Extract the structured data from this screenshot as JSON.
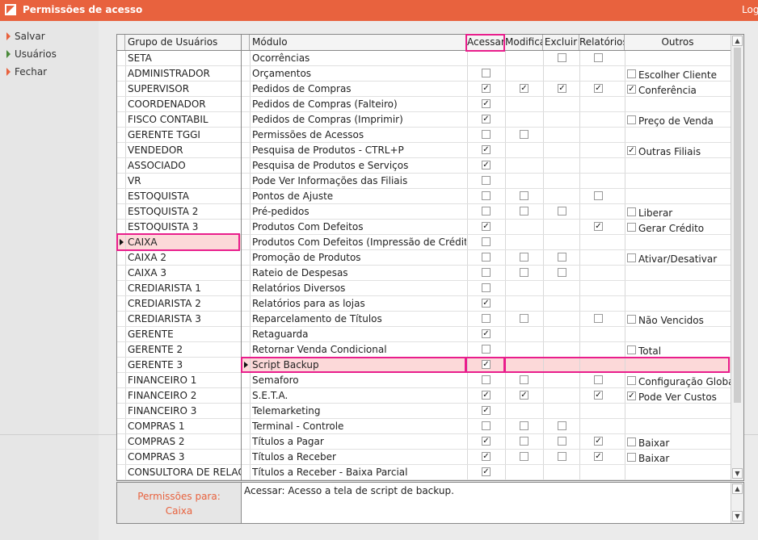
{
  "window": {
    "title": "Permissões de acesso",
    "logout_label": "Log"
  },
  "sidebar": {
    "items": [
      {
        "label": "Salvar"
      },
      {
        "label": "Usuários"
      },
      {
        "label": "Fechar"
      }
    ]
  },
  "groups": {
    "header": "Grupo de Usuários",
    "selected": "CAIXA",
    "rows": [
      "SETA",
      "ADMINISTRADOR",
      "SUPERVISOR",
      "COORDENADOR",
      "FISCO CONTABIL",
      "GERENTE TGGI",
      "VENDEDOR",
      "ASSOCIADO",
      "VR",
      "ESTOQUISTA",
      "ESTOQUISTA 2",
      "ESTOQUISTA 3",
      "CAIXA",
      "CAIXA 2",
      "CAIXA 3",
      "CREDIARISTA 1",
      "CREDIARISTA 2",
      "CREDIARISTA 3",
      "GERENTE",
      "GERENTE 2",
      "GERENTE 3",
      "FINANCEIRO 1",
      "FINANCEIRO 2",
      "FINANCEIRO 3",
      "COMPRAS 1",
      "COMPRAS 2",
      "COMPRAS 3",
      "CONSULTORA DE RELACI"
    ]
  },
  "permissions_for": {
    "label": "Permissões para:",
    "value": "Caixa"
  },
  "modules": {
    "headers": {
      "modulo": "Módulo",
      "acessar": "Acessar",
      "modifica": "Modifica",
      "excluir": "Excluir",
      "relatorios": "Relatórios",
      "outros": "Outros"
    },
    "selected": "Script Backup",
    "rows": [
      {
        "name": "Ocorrências",
        "acessar": null,
        "modifica": null,
        "excluir": false,
        "relatorios": false,
        "outros": null,
        "outros_checked": false
      },
      {
        "name": "Orçamentos",
        "acessar": false,
        "modifica": null,
        "excluir": null,
        "relatorios": null,
        "outros": "Escolher Cliente",
        "outros_checked": false
      },
      {
        "name": "Pedidos de Compras",
        "acessar": true,
        "modifica": true,
        "excluir": true,
        "relatorios": true,
        "outros": "Conferência",
        "outros_checked": true
      },
      {
        "name": "Pedidos de Compras (Falteiro)",
        "acessar": true,
        "modifica": null,
        "excluir": null,
        "relatorios": null,
        "outros": null,
        "outros_checked": false
      },
      {
        "name": "Pedidos de Compras (Imprimir)",
        "acessar": true,
        "modifica": null,
        "excluir": null,
        "relatorios": null,
        "outros": "Preço de Venda",
        "outros_checked": false
      },
      {
        "name": "Permissões de Acessos",
        "acessar": false,
        "modifica": false,
        "excluir": null,
        "relatorios": null,
        "outros": null,
        "outros_checked": false
      },
      {
        "name": "Pesquisa de Produtos - CTRL+P",
        "acessar": true,
        "modifica": null,
        "excluir": null,
        "relatorios": null,
        "outros": "Outras Filiais",
        "outros_checked": true
      },
      {
        "name": "Pesquisa de Produtos e Serviços",
        "acessar": true,
        "modifica": null,
        "excluir": null,
        "relatorios": null,
        "outros": null,
        "outros_checked": false
      },
      {
        "name": "Pode Ver Informações das Filiais",
        "acessar": false,
        "modifica": null,
        "excluir": null,
        "relatorios": null,
        "outros": null,
        "outros_checked": false
      },
      {
        "name": "Pontos de Ajuste",
        "acessar": false,
        "modifica": false,
        "excluir": null,
        "relatorios": false,
        "outros": null,
        "outros_checked": false
      },
      {
        "name": "Pré-pedidos",
        "acessar": false,
        "modifica": false,
        "excluir": false,
        "relatorios": null,
        "outros": "Liberar",
        "outros_checked": false
      },
      {
        "name": "Produtos Com Defeitos",
        "acessar": true,
        "modifica": null,
        "excluir": null,
        "relatorios": true,
        "outros": "Gerar Crédito",
        "outros_checked": false
      },
      {
        "name": "Produtos Com Defeitos (Impressão de Crédito)",
        "acessar": false,
        "modifica": null,
        "excluir": null,
        "relatorios": null,
        "outros": null,
        "outros_checked": false
      },
      {
        "name": "Promoção de Produtos",
        "acessar": false,
        "modifica": false,
        "excluir": false,
        "relatorios": null,
        "outros": "Ativar/Desativar",
        "outros_checked": false
      },
      {
        "name": "Rateio de Despesas",
        "acessar": false,
        "modifica": false,
        "excluir": false,
        "relatorios": null,
        "outros": null,
        "outros_checked": false
      },
      {
        "name": "Relatórios Diversos",
        "acessar": false,
        "modifica": null,
        "excluir": null,
        "relatorios": null,
        "outros": null,
        "outros_checked": false
      },
      {
        "name": "Relatórios para as lojas",
        "acessar": true,
        "modifica": null,
        "excluir": null,
        "relatorios": null,
        "outros": null,
        "outros_checked": false
      },
      {
        "name": "Reparcelamento de Títulos",
        "acessar": false,
        "modifica": false,
        "excluir": null,
        "relatorios": false,
        "outros": "Não Vencidos",
        "outros_checked": false
      },
      {
        "name": "Retaguarda",
        "acessar": true,
        "modifica": null,
        "excluir": null,
        "relatorios": null,
        "outros": null,
        "outros_checked": false
      },
      {
        "name": "Retornar Venda Condicional",
        "acessar": false,
        "modifica": null,
        "excluir": null,
        "relatorios": null,
        "outros": "Total",
        "outros_checked": false
      },
      {
        "name": "Script Backup",
        "acessar": true,
        "modifica": null,
        "excluir": null,
        "relatorios": null,
        "outros": null,
        "outros_checked": false
      },
      {
        "name": "Semaforo",
        "acessar": false,
        "modifica": false,
        "excluir": null,
        "relatorios": false,
        "outros": "Configuração Global",
        "outros_checked": false
      },
      {
        "name": "S.E.T.A.",
        "acessar": true,
        "modifica": true,
        "excluir": null,
        "relatorios": true,
        "outros": "Pode Ver Custos",
        "outros_checked": true
      },
      {
        "name": "Telemarketing",
        "acessar": true,
        "modifica": null,
        "excluir": null,
        "relatorios": null,
        "outros": null,
        "outros_checked": false
      },
      {
        "name": "Terminal - Controle",
        "acessar": false,
        "modifica": false,
        "excluir": false,
        "relatorios": null,
        "outros": null,
        "outros_checked": false
      },
      {
        "name": "Títulos a Pagar",
        "acessar": true,
        "modifica": false,
        "excluir": false,
        "relatorios": true,
        "outros": "Baixar",
        "outros_checked": false
      },
      {
        "name": "Títulos a Receber",
        "acessar": true,
        "modifica": false,
        "excluir": false,
        "relatorios": true,
        "outros": "Baixar",
        "outros_checked": false
      },
      {
        "name": "Títulos a Receber - Baixa Parcial",
        "acessar": true,
        "modifica": null,
        "excluir": null,
        "relatorios": null,
        "outros": null,
        "outros_checked": false
      }
    ]
  },
  "description": {
    "text": "Acessar: Acesso a tela de script de backup."
  },
  "colors": {
    "accent": "#e8623e",
    "highlight": "#e91e8c",
    "selected_row": "#fcd9d9"
  }
}
